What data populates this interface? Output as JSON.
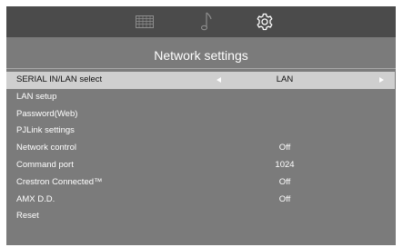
{
  "tabs": [
    {
      "icon": "picture-grid-icon",
      "active": false
    },
    {
      "icon": "music-note-icon",
      "active": false
    },
    {
      "icon": "gear-icon",
      "active": true
    }
  ],
  "title": "Network settings",
  "menu": {
    "items": [
      {
        "label": "SERIAL IN/LAN select",
        "value": "LAN"
      },
      {
        "label": "LAN setup",
        "value": ""
      },
      {
        "label": "Password(Web)",
        "value": ""
      },
      {
        "label": "PJLink settings",
        "value": ""
      },
      {
        "label": "Network control",
        "value": "Off"
      },
      {
        "label": "Command port",
        "value": "1024"
      },
      {
        "label": "Crestron Connected™",
        "value": "Off"
      },
      {
        "label": "AMX D.D.",
        "value": "Off"
      },
      {
        "label": "Reset",
        "value": ""
      }
    ]
  },
  "colors": {
    "panel": "#7b7b7b",
    "tabbar": "#4b4b4b",
    "selected_row": "#cfcfcf",
    "text": "#ffffff"
  }
}
